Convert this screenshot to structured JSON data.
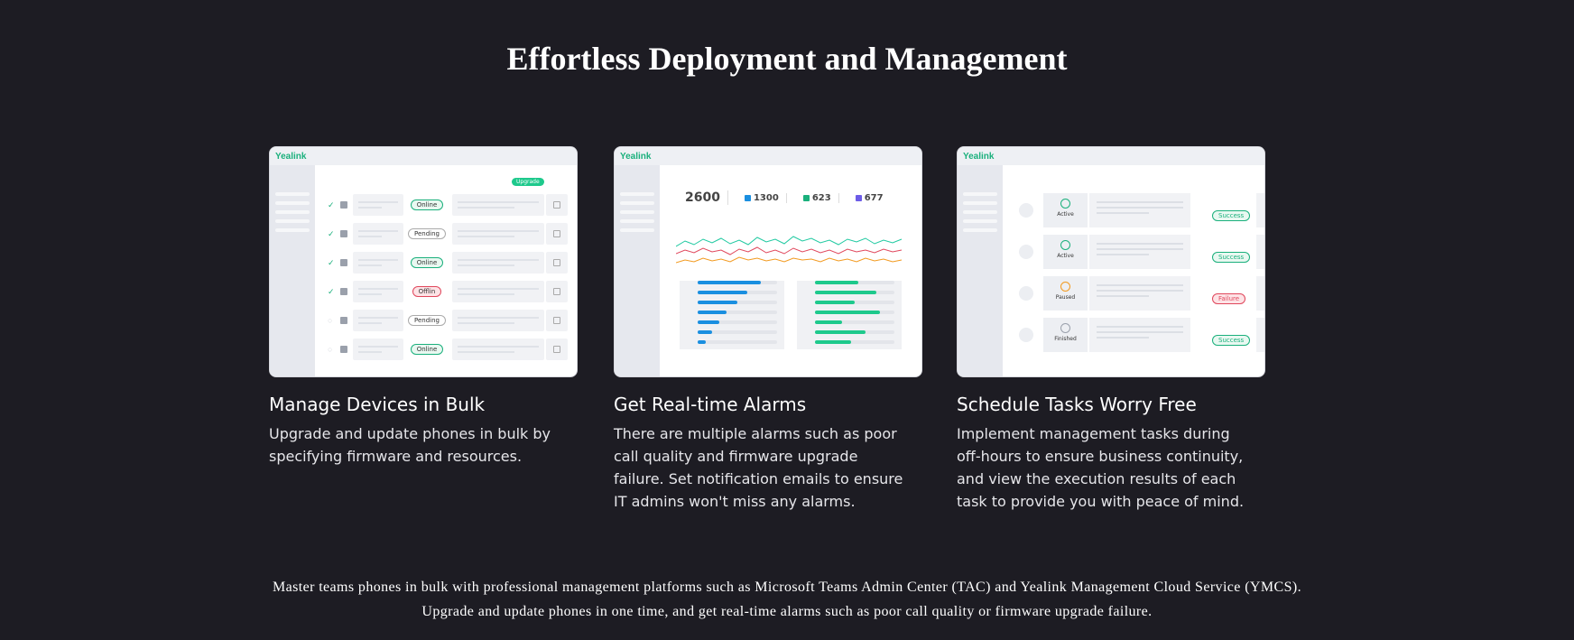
{
  "page": {
    "title": "Effortless Deployment and Management",
    "footer_line1": "Master teams phones in bulk with professional management platforms such as Microsoft Teams Admin Center (TAC) and Yealink Management Cloud Service (YMCS).",
    "footer_line2": "Upgrade and update phones in one time, and get real-time alarms such as poor call quality or firmware upgrade failure."
  },
  "cards": [
    {
      "heading": "Manage Devices in Bulk",
      "description": "Upgrade and update phones in bulk by specifying firmware and resources.",
      "logo": "Yealink",
      "upgrade_label": "Upgrade",
      "statuses": [
        "Online",
        "Pending",
        "Online",
        "Offlin",
        "Pending",
        "Online"
      ]
    },
    {
      "heading": "Get Real-time Alarms",
      "description": "There are multiple alarms such as poor call quality and firmware upgrade failure. Set notification emails to ensure IT admins won't miss any alarms.",
      "logo": "Yealink",
      "stats": [
        "2600",
        "1300",
        "623",
        "677"
      ]
    },
    {
      "heading": "Schedule Tasks Worry Free",
      "description": "Implement management tasks during off-hours to ensure business continuity, and view the execution results of each task to provide you with peace of mind.",
      "logo": "Yealink",
      "task_states": [
        "Active",
        "Active",
        "Paused",
        "Finished"
      ],
      "task_results": [
        "Success",
        "Success",
        "Failure",
        "Success"
      ]
    }
  ],
  "colors": {
    "background": "#1d1c23",
    "accent_green": "#1ab07c",
    "accent_blue": "#1a8fe0",
    "alarm_red": "#e0475c",
    "alarm_orange": "#f29a1f"
  }
}
